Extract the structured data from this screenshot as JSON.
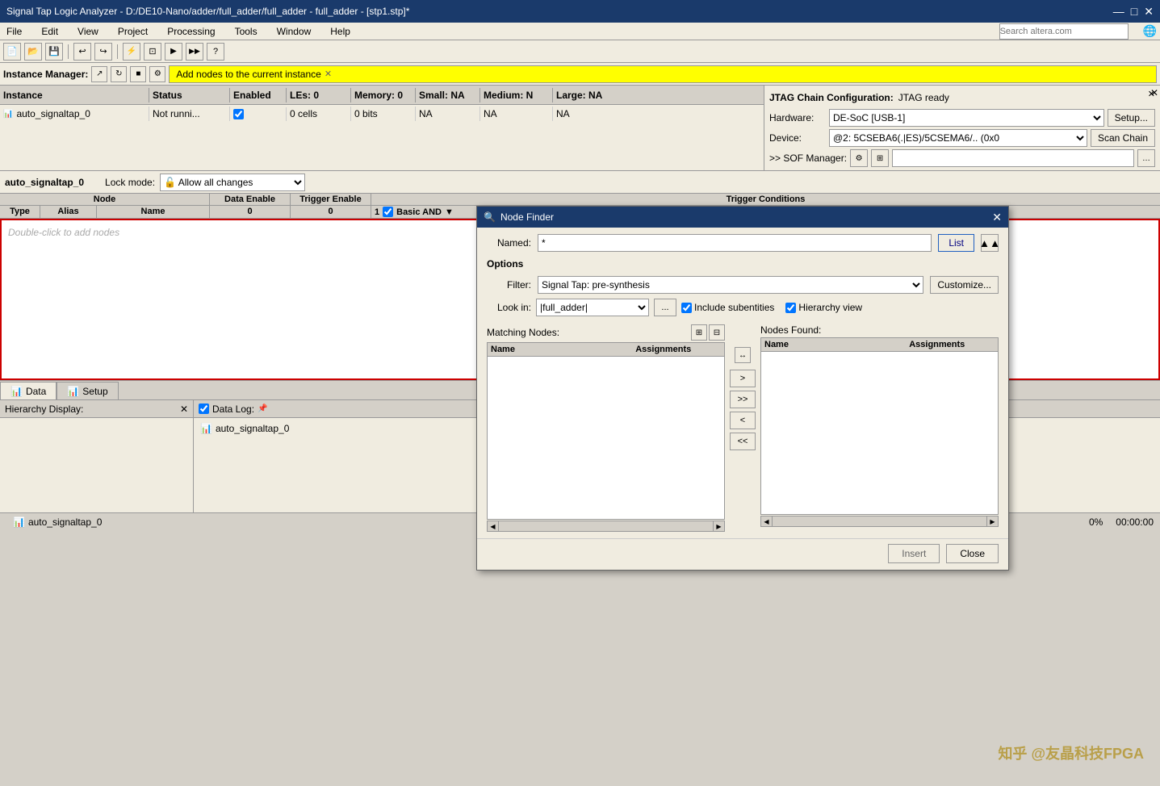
{
  "titlebar": {
    "title": "Signal Tap Logic Analyzer - D:/DE10-Nano/adder/full_adder/full_adder - full_adder - [stp1.stp]*",
    "minimize": "—",
    "maximize": "□",
    "close": "✕"
  },
  "menubar": {
    "items": [
      "File",
      "Edit",
      "View",
      "Project",
      "Processing",
      "Tools",
      "Window",
      "Help"
    ]
  },
  "search": {
    "placeholder": "Search altera.com"
  },
  "instance_manager": {
    "label": "Instance Manager:",
    "banner_text": "Add nodes to the current instance",
    "banner_close": "✕"
  },
  "instance_table": {
    "headers": [
      "Instance",
      "Status",
      "Enabled",
      "LEs: 0",
      "Memory: 0",
      "Small: NA",
      "Medium: N",
      "Large: NA"
    ],
    "row": {
      "name": "auto_signaltap_0",
      "status": "Not runni...",
      "enabled": "☑",
      "les": "0 cells",
      "memory": "0 bits",
      "small": "NA",
      "medium": "NA",
      "large": "NA"
    }
  },
  "jtag": {
    "title": "JTAG Chain Configuration:",
    "status": "JTAG ready",
    "hardware_label": "Hardware:",
    "hardware_value": "DE-SoC [USB-1]",
    "setup_btn": "Setup...",
    "device_label": "Device:",
    "device_value": "@2: 5CSEBA6(.|ES)/5CSEMA6/.. (0x0",
    "scan_chain_btn": "Scan Chain",
    "sof_label": ">> SOF Manager:",
    "close_btn": "✕"
  },
  "node_area": {
    "instance_name": "auto_signaltap_0",
    "lock_mode_label": "Lock mode:",
    "lock_mode_icon": "🔓",
    "lock_mode_value": "Allow all changes",
    "node_col_node": "Node",
    "node_col_data": "Data Enable",
    "node_col_trigger": "Trigger Enable",
    "node_col_trigger_cond": "Trigger Conditions",
    "sub_type": "Type",
    "sub_alias": "Alias",
    "sub_name": "Name",
    "sub_data_val": "0",
    "sub_trigger_val": "0",
    "sub_trigger_cond_val": "1",
    "trigger_cond_type": "Basic AND",
    "empty_hint": "Double-click to add nodes"
  },
  "tabs": {
    "data_label": "Data",
    "setup_label": "Setup"
  },
  "bottom": {
    "hierarchy_label": "Hierarchy Display:",
    "hierarchy_close": "✕",
    "data_log_label": "Data Log:",
    "data_log_item": "auto_signaltap_0"
  },
  "status_bar": {
    "percentage": "0%",
    "time": "00:00:00"
  },
  "node_finder": {
    "title": "Node Finder",
    "named_label": "Named:",
    "named_value": "*",
    "list_btn": "List",
    "up_btn": "▲",
    "options_label": "Options",
    "filter_label": "Filter:",
    "filter_value": "Signal Tap: pre-synthesis",
    "customize_btn": "Customize...",
    "lookin_label": "Look in:",
    "lookin_value": "|full_adder|",
    "browse_btn": "...",
    "include_sub_label": "Include subentities",
    "hierarchy_view_label": "Hierarchy view",
    "matching_nodes_label": "Matching Nodes:",
    "nodes_found_label": "Nodes Found:",
    "col_name": "Name",
    "col_assign": "Assignments",
    "transfer_btn_right": ">",
    "transfer_btn_right_all": ">>",
    "transfer_btn_left": "<",
    "transfer_btn_left_all": "<<",
    "insert_btn": "Insert",
    "close_btn": "Close",
    "close_icon": "✕"
  }
}
